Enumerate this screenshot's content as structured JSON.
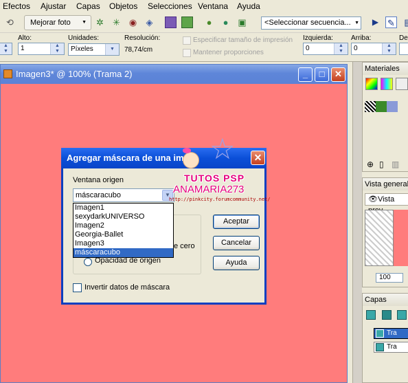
{
  "menubar": {
    "items": [
      "Efectos",
      "Ajustar",
      "Capas",
      "Objetos",
      "Selecciones",
      "Ventana",
      "Ayuda"
    ]
  },
  "toolbar": {
    "enhance_label": "Mejorar foto",
    "sequence_placeholder": "<Seleccionar secuencia..."
  },
  "options": {
    "alto_label": "Alto:",
    "alto_value": "1",
    "unidades_label": "Unidades:",
    "unidades_value": "Píxeles",
    "resolucion_label": "Resolución:",
    "resolucion_value": "78,74/cm",
    "print_size_label": "Especificar tamaño de impresión",
    "keep_prop_label": "Mantener proporciones",
    "izquierda_label": "Izquierda:",
    "izquierda_value": "0",
    "arriba_label": "Arriba:",
    "arriba_value": "0",
    "derecha_label": "Der"
  },
  "document": {
    "title": "Imagen3* @ 100% (Trama 2)",
    "canvas_color": "#ff7c7c"
  },
  "dialog": {
    "title": "Agregar máscara de una ima",
    "source_label": "Ventana origen",
    "source_value": "máscaracubo",
    "source_options": [
      "Imagen1",
      "sexydarkUNIVERSO",
      "Imagen2",
      "Georgia-Ballet",
      "Imagen3",
      "máscaracubo"
    ],
    "selected_index": 5,
    "radio_partial": "e cero",
    "radio_opacity": "Opacidad de origen",
    "invert_label": "Invertir datos de máscara",
    "ok": "Aceptar",
    "cancel": "Cancelar",
    "help": "Ayuda"
  },
  "watermark": {
    "line1": "TUTOS PSP",
    "line2": "ANAMARIA273",
    "line3": "http://pinkcity.forumcommunity.net/"
  },
  "panels": {
    "materiales": "Materiales",
    "vista_general": "Vista general",
    "vista_tab": "Vista prev",
    "zoom_value": "100",
    "capas": "Capas",
    "layer1": "Tra",
    "layer2": "Tra"
  }
}
